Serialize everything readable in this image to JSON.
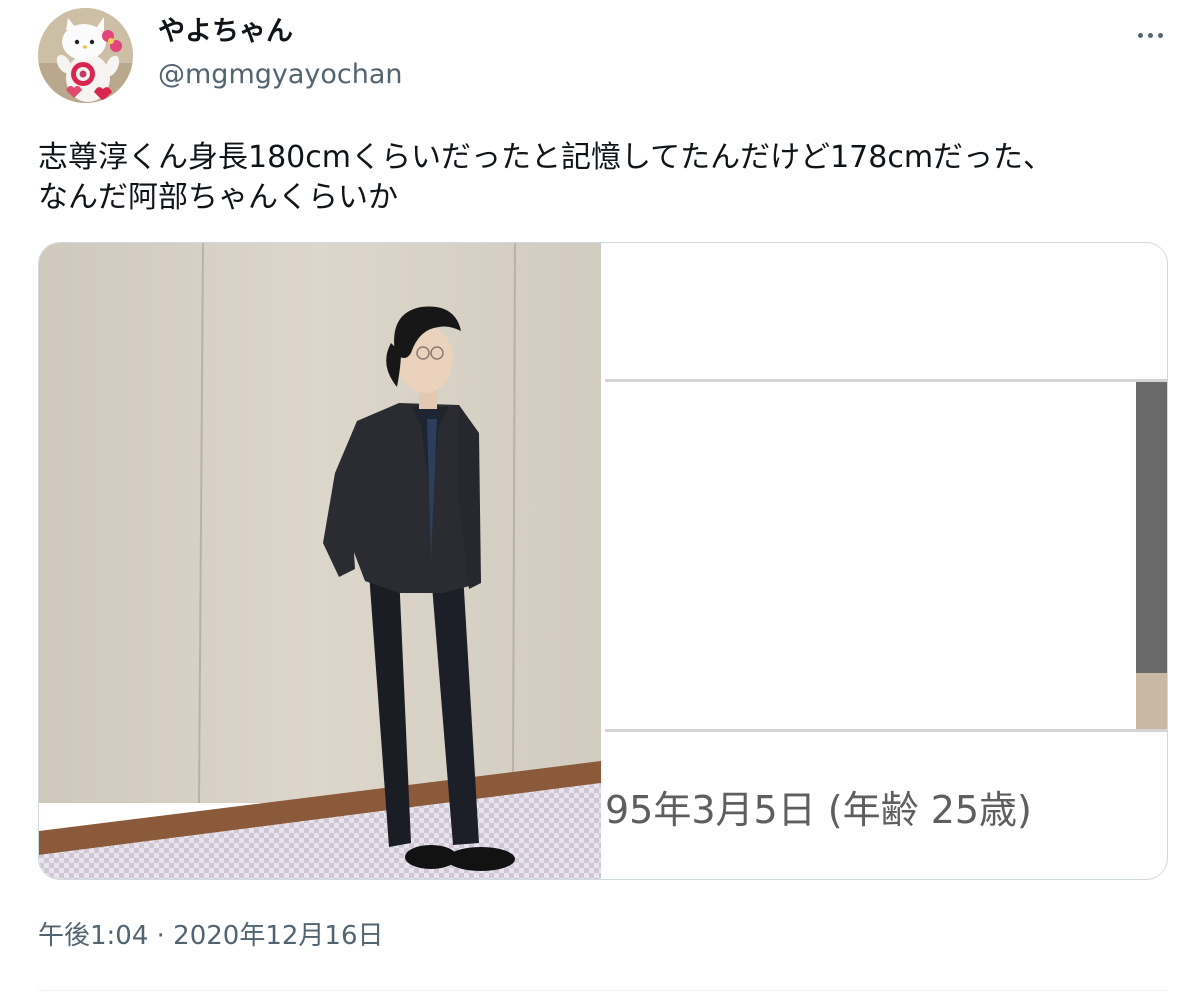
{
  "user": {
    "display_name": "やよちゃん",
    "handle": "@mgmgyayochan"
  },
  "tweet": {
    "text_lines": [
      "志尊淳くん身長180cmくらいだったと記憶してたんだけど178cmだった、",
      "なんだ阿部ちゃんくらいか"
    ],
    "timestamp": "午後1:04 · 2020年12月16日"
  },
  "media": {
    "right_image_caption": "95年3月5日 (年齢 25歳)"
  },
  "icons": {
    "more": "more-horizontal-icon"
  },
  "colors": {
    "text_primary": "#0f1419",
    "text_secondary": "#536471",
    "border": "#cfd9de"
  }
}
